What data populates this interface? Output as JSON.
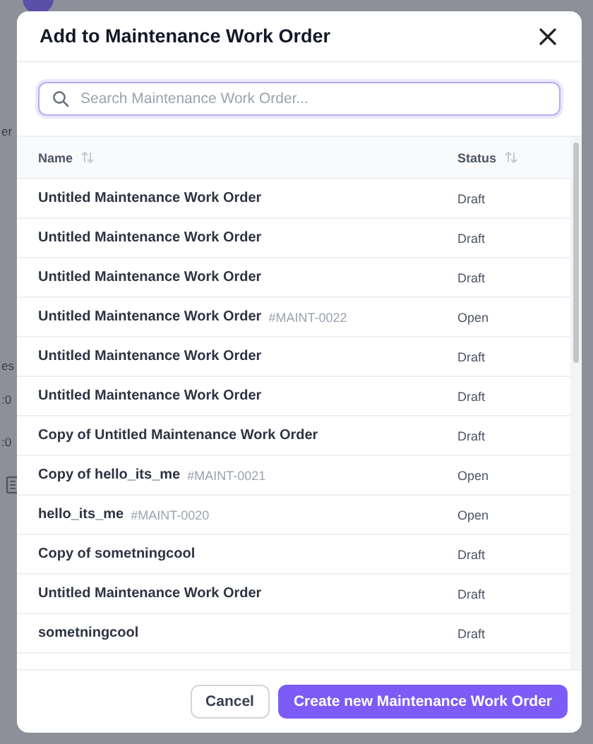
{
  "background": {
    "fragments": [
      "er",
      "es",
      ":0",
      ":0"
    ]
  },
  "dialog": {
    "title": "Add to Maintenance Work Order",
    "search": {
      "placeholder": "Search Maintenance Work Order..."
    },
    "table": {
      "columns": [
        {
          "label": "Name"
        },
        {
          "label": "Status"
        }
      ],
      "rows": [
        {
          "name": "Untitled Maintenance Work Order",
          "status": "Draft"
        },
        {
          "name": "Untitled Maintenance Work Order",
          "status": "Draft"
        },
        {
          "name": "Untitled Maintenance Work Order",
          "status": "Draft"
        },
        {
          "name": "Untitled Maintenance Work Order",
          "code": "#MAINT-0022",
          "status": "Open"
        },
        {
          "name": "Untitled Maintenance Work Order",
          "status": "Draft"
        },
        {
          "name": "Untitled Maintenance Work Order",
          "status": "Draft"
        },
        {
          "name": "Copy of Untitled Maintenance Work Order",
          "status": "Draft"
        },
        {
          "name": "Copy of hello_its_me",
          "code": "#MAINT-0021",
          "status": "Open"
        },
        {
          "name": "hello_its_me",
          "code": "#MAINT-0020",
          "status": "Open"
        },
        {
          "name": "Copy of sometningcool",
          "status": "Draft"
        },
        {
          "name": "Untitled Maintenance Work Order",
          "status": "Draft"
        },
        {
          "name": "sometningcool",
          "status": "Draft"
        }
      ]
    },
    "buttons": {
      "cancel": "Cancel",
      "create": "Create new Maintenance Work Order"
    }
  }
}
